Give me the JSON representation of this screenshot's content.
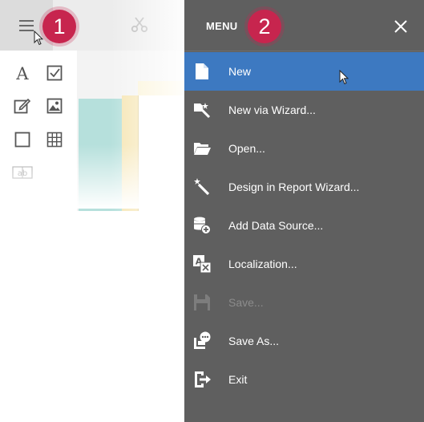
{
  "steps": {
    "one": "1",
    "two": "2"
  },
  "menu": {
    "title": "MENU",
    "items": [
      {
        "label": "New",
        "icon": "new-document-icon",
        "state": "active"
      },
      {
        "label": "New via Wizard...",
        "icon": "wizard-new-icon",
        "state": "enabled"
      },
      {
        "label": "Open...",
        "icon": "folder-open-icon",
        "state": "enabled"
      },
      {
        "label": "Design in Report Wizard...",
        "icon": "magic-wand-icon",
        "state": "enabled"
      },
      {
        "label": "Add Data Source...",
        "icon": "database-add-icon",
        "state": "enabled"
      },
      {
        "label": "Localization...",
        "icon": "translate-icon",
        "state": "enabled"
      },
      {
        "label": "Save...",
        "icon": "save-icon",
        "state": "disabled"
      },
      {
        "label": "Save As...",
        "icon": "save-as-icon",
        "state": "enabled"
      },
      {
        "label": "Exit",
        "icon": "exit-icon",
        "state": "enabled"
      }
    ]
  },
  "toolbox": {
    "items": [
      "text-tool-icon",
      "checkbox-tool-icon",
      "richtext-tool-icon",
      "picture-tool-icon",
      "shape-tool-icon",
      "table-tool-icon",
      "label-tool-icon"
    ],
    "label_tool_text": "ab"
  },
  "colors": {
    "menu_bg": "#5f5f5f",
    "active": "#3d79c1",
    "badge": "#c7254e",
    "disabled": "#8c8c8c"
  }
}
